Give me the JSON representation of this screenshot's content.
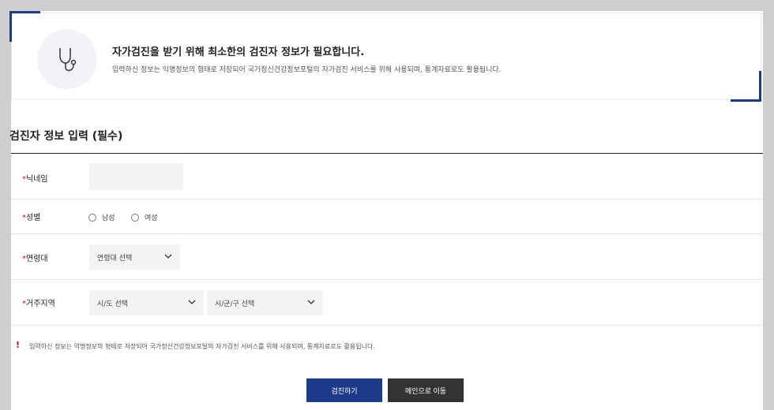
{
  "info": {
    "title": "자가검진을 받기 위해 최소한의 검진자 정보가 필요합니다.",
    "description": "입력하신 정보는 익명정보의 형태로 저장되어 국가정신건강정보포털의 자가검진 서비스를 위해 사용되며, 통계자료로도 활용됩니다.",
    "icon": "stethoscope-icon"
  },
  "section": {
    "title": "검진자 정보 입력 (필수)"
  },
  "form": {
    "required_mark": "*",
    "nickname_label": "닉네임",
    "nickname_value": "",
    "gender_label": "성별",
    "gender_options": [
      "남성",
      "여성"
    ],
    "age_label": "연령대",
    "age_select": "연령대 선택",
    "region_label": "거주지역",
    "region_select_1": "시/도 선택",
    "region_select_2": "시/군/구 선택"
  },
  "notice": {
    "mark": "!",
    "text": "입력하신 정보는 익명정보의 형태로 저장되어 국가정신건강정보포털의 자가검진 서비스를 위해 사용되며, 통계자료로도 활용됩니다."
  },
  "buttons": {
    "submit": "검진하기",
    "main": "메인으로 이동"
  },
  "colors": {
    "accent": "#1c3a8a",
    "required": "#d0021b",
    "dark_button": "#333333"
  }
}
